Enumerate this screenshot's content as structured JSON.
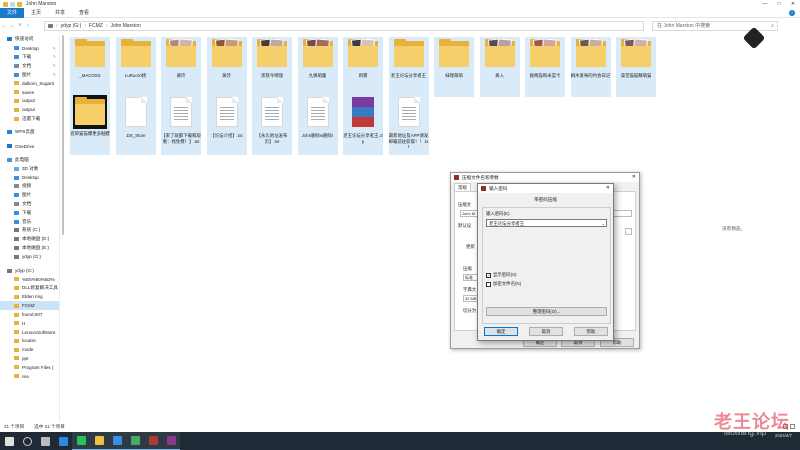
{
  "window": {
    "title": "John Marston",
    "controls": [
      "—",
      "□",
      "✕"
    ]
  },
  "ribbon": {
    "tabs": [
      "文件",
      "主页",
      "共享",
      "查看"
    ],
    "help": "?"
  },
  "address": {
    "crumbs": [
      "ydyp (G:)",
      "FCMZ",
      "John Marston"
    ],
    "search_placeholder": "在 John Marston 中搜索"
  },
  "sidebar": {
    "items": [
      {
        "label": "快速访问",
        "icon": "star-icon",
        "color": "#1979ca",
        "indent": false
      },
      {
        "label": "Desktop",
        "icon": "folder-icon",
        "color": "#3a8ee6",
        "indent": true,
        "pin": true
      },
      {
        "label": "下载",
        "icon": "download-icon",
        "color": "#3a8ee6",
        "indent": true,
        "pin": true
      },
      {
        "label": "文档",
        "icon": "document-icon",
        "color": "#7a8a99",
        "indent": true,
        "pin": true
      },
      {
        "label": "图片",
        "icon": "picture-icon",
        "color": "#3a8ee6",
        "indent": true,
        "pin": true
      },
      {
        "label": "dalkom_Sugarti",
        "icon": "folder-icon",
        "color": "#e8b13a",
        "indent": true
      },
      {
        "label": "saves",
        "icon": "folder-icon",
        "color": "#e8b13a",
        "indent": true
      },
      {
        "label": "output",
        "icon": "folder-icon",
        "color": "#e8b13a",
        "indent": true
      },
      {
        "label": "output",
        "icon": "folder-icon",
        "color": "#e8b13a",
        "indent": true
      },
      {
        "label": "迅雷下载",
        "icon": "folder-icon",
        "color": "#e8b13a",
        "indent": true
      },
      {
        "label": "WPS云盘",
        "icon": "cloud-icon",
        "color": "#2a7de1",
        "indent": false,
        "gap": true
      },
      {
        "label": "OneDrive",
        "icon": "cloud-icon",
        "color": "#1a73c7",
        "indent": false,
        "gap": true
      },
      {
        "label": "此电脑",
        "icon": "computer-icon",
        "color": "#4a90d9",
        "indent": false,
        "gap": true
      },
      {
        "label": "3D 对象",
        "icon": "cube-icon",
        "color": "#6aa7e0",
        "indent": true
      },
      {
        "label": "Desktop",
        "icon": "folder-icon",
        "color": "#3a8ee6",
        "indent": true
      },
      {
        "label": "视频",
        "icon": "video-icon",
        "color": "#7a8a99",
        "indent": true
      },
      {
        "label": "图片",
        "icon": "picture-icon",
        "color": "#3a8ee6",
        "indent": true
      },
      {
        "label": "文档",
        "icon": "document-icon",
        "color": "#7a8a99",
        "indent": true
      },
      {
        "label": "下载",
        "icon": "download-icon",
        "color": "#3a8ee6",
        "indent": true
      },
      {
        "label": "音乐",
        "icon": "music-icon",
        "color": "#3a8ee6",
        "indent": true
      },
      {
        "label": "系统 (C:)",
        "icon": "drive-icon",
        "color": "#6a7a8a",
        "indent": true
      },
      {
        "label": "本地磁盘 (D:)",
        "icon": "drive-icon",
        "color": "#6a7a8a",
        "indent": true
      },
      {
        "label": "本地磁盘 (E:)",
        "icon": "drive-icon",
        "color": "#6a7a8a",
        "indent": true
      },
      {
        "label": "ydyp (G:)",
        "icon": "drive-icon",
        "color": "#6a7a8a",
        "indent": true
      },
      {
        "label": "ydyp (G:)",
        "icon": "drive-icon",
        "color": "#6a7a8a",
        "indent": false,
        "gap": true
      },
      {
        "label": "%E5%80%B3%",
        "icon": "folder-icon",
        "color": "#e8b13a",
        "indent": true
      },
      {
        "label": "DLL修复解决工具",
        "icon": "folder-icon",
        "color": "#e8b13a",
        "indent": true
      },
      {
        "label": "Elden ring",
        "icon": "folder-icon",
        "color": "#e8b13a",
        "indent": true
      },
      {
        "label": "FCMZ",
        "icon": "folder-icon",
        "color": "#e8b13a",
        "indent": true,
        "selected": true
      },
      {
        "label": "found.007",
        "icon": "folder-icon",
        "color": "#e8b13a",
        "indent": true
      },
      {
        "label": "H",
        "icon": "folder-icon",
        "color": "#e8b13a",
        "indent": true
      },
      {
        "label": "LenovoSoftstore",
        "icon": "folder-icon",
        "color": "#e8b13a",
        "indent": true
      },
      {
        "label": "localec",
        "icon": "folder-icon",
        "color": "#e8b13a",
        "indent": true
      },
      {
        "label": "mode",
        "icon": "folder-icon",
        "color": "#e8b13a",
        "indent": true
      },
      {
        "label": "ppt",
        "icon": "folder-icon",
        "color": "#e8b13a",
        "indent": true
      },
      {
        "label": "Program Files (",
        "icon": "folder-icon",
        "color": "#e8b13a",
        "indent": true
      },
      {
        "label": "rea",
        "icon": "folder-icon",
        "color": "#e8b13a",
        "indent": true
      }
    ]
  },
  "files": [
    {
      "label": "_MACOSX",
      "kind": "folder"
    },
    {
      "label": "LuRuoXi杨",
      "kind": "folder"
    },
    {
      "label": "黄玲",
      "kind": "folder-pic",
      "pics": [
        "#b08a7a",
        "#d6b2a0"
      ]
    },
    {
      "label": "黄玲",
      "kind": "folder-pic",
      "pics": [
        "#8a5a3a",
        "#c79a7a"
      ]
    },
    {
      "label": "黑铁今晴瑞",
      "kind": "folder-pic",
      "pics": [
        "#4a3a3a",
        "#c2a6a0"
      ]
    },
    {
      "label": "九條萌蕾",
      "kind": "folder-pic",
      "pics": [
        "#7a4a4a",
        "#a86a5a"
      ]
    },
    {
      "label": "刺猬",
      "kind": "folder-pic",
      "pics": [
        "#3a3a4a",
        "#d9c3b0"
      ]
    },
    {
      "label": "老王论坛分享者王",
      "kind": "folder"
    },
    {
      "label": "妹哩萌萌",
      "kind": "folder"
    },
    {
      "label": "黄入",
      "kind": "folder-pic",
      "pics": [
        "#5a4a5a",
        "#b8a0a0"
      ]
    },
    {
      "label": "拨两猫和米昊卡",
      "kind": "folder-pic",
      "pics": [
        "#9a5a5a",
        "#d0a8a0"
      ]
    },
    {
      "label": "桐木爱咪的约会日记",
      "kind": "folder-pic",
      "pics": [
        "#6a5a4a",
        "#c8b098"
      ]
    },
    {
      "label": "澡堂猫猫精萌猫",
      "kind": "folder-pic",
      "pics": [
        "#7a5a5a",
        "#d0b0a8"
      ]
    },
    {
      "label": "逛郎猫猫爆更多骷髅",
      "kind": "folder-dark"
    },
    {
      "label": ".DS_Store",
      "kind": "doc"
    },
    {
      "label": "【来了就都下载和观看：找免费！】.txt",
      "kind": "doc"
    },
    {
      "label": "【论坛介绍】.txt",
      "kind": "doc"
    },
    {
      "label": "【永久地址发布页】.txt",
      "kind": "doc"
    },
    {
      "label": "John删除w删除r",
      "kind": "doc"
    },
    {
      "label": "老王论坛分享者王.zip",
      "kind": "rar"
    },
    {
      "label": "最新地址及APP请发邮箱前往获取！！.txt",
      "kind": "doc"
    }
  ],
  "preview_message": "没有预览。",
  "status": {
    "count": "21 个项目",
    "selected": "选中 21 个项目"
  },
  "archive_dialog": {
    "title": "压缩文件名和参数",
    "tab": "常规",
    "label_name": "压缩文",
    "name_value": "John M",
    "label_default": "默认设",
    "label_update": "更新",
    "label_format": "压缩",
    "label_format2": "标准",
    "label_dict": "字典大",
    "label_dict_val": "32 MB",
    "label_split": "切分为",
    "btn_ok": "确定",
    "btn_cancel": "取消",
    "btn_help": "帮助"
  },
  "password_dialog": {
    "title": "输入密码",
    "header": "带密码压缩",
    "label": "输入密码(E)",
    "value": "老王论坛分享者王",
    "show_password": "显示密码(S)",
    "show_password_checked": true,
    "encrypt_names": "加密文件名(N)",
    "encrypt_names_checked": false,
    "manage_button": "整理密码(O)...",
    "ok": "确定",
    "cancel": "取消",
    "help": "帮助"
  },
  "watermark": {
    "text": "老王论坛",
    "sub": "laowang.vip"
  },
  "tray": {
    "time": "",
    "date": "2024/4/7"
  },
  "taskbar_icons": [
    "windows-start-icon",
    "search-icon",
    "task-view-icon",
    "edge-icon",
    "wechat-icon",
    "file-explorer-icon",
    "app-icon",
    "game-icon",
    "browser-icon",
    "winrar-icon"
  ],
  "taskbar_colors": [
    "#e0e0e0",
    "#cccccc",
    "#bbbbbb",
    "#2b8ae0",
    "#28c25a",
    "#f0c040",
    "#3a8ee6",
    "#4aa86a",
    "#ad3a3a",
    "#8a3a8a"
  ]
}
